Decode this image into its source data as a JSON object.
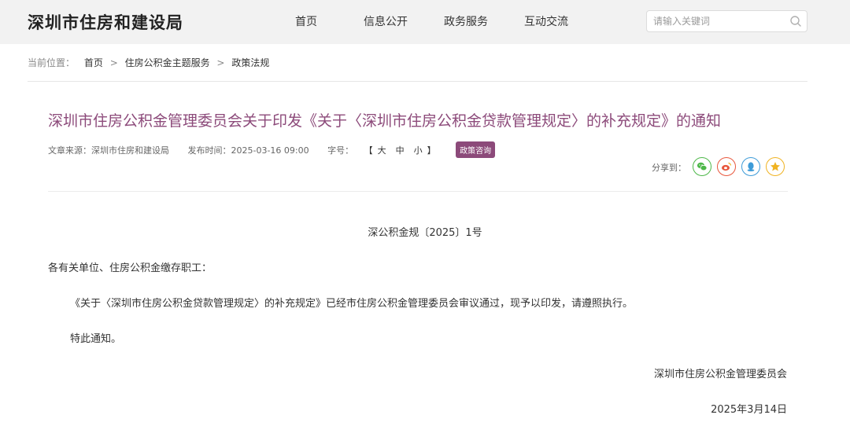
{
  "header": {
    "site_title": "深圳市住房和建设局",
    "nav": [
      "首页",
      "信息公开",
      "政务服务",
      "互动交流"
    ],
    "search_placeholder": "请输入关键词"
  },
  "breadcrumb": {
    "label": "当前位置：",
    "items": [
      "首页",
      "住房公积金主题服务",
      "政策法规"
    ],
    "separator": ">"
  },
  "article": {
    "title": "深圳市住房公积金管理委员会关于印发《关于〈深圳市住房公积金贷款管理规定〉的补充规定》的通知",
    "source": "文章来源：深圳市住房和建设局",
    "published": "发布时间：2025-03-16 09:00",
    "font_size_label": "字号：",
    "font_size_open": "【",
    "font_size_options": [
      "大",
      "中",
      "小"
    ],
    "font_size_close": "】",
    "badge": "政策咨询",
    "share_label": "分享到："
  },
  "body": {
    "doc_number": "深公积金规〔2025〕1号",
    "salutation": "各有关单位、住房公积金缴存职工：",
    "paragraph": "《关于〈深圳市住房公积金贷款管理规定〉的补充规定》已经市住房公积金管理委员会审议通过，现予以印发，请遵照执行。",
    "closing": "特此通知。",
    "signer": "深圳市住房公积金管理委员会",
    "date": "2025年3月14日"
  },
  "share_icons": [
    {
      "name": "wechat-icon",
      "color": "#4cb748"
    },
    {
      "name": "weibo-icon",
      "color": "#e8573c"
    },
    {
      "name": "qq-icon",
      "color": "#3d9bd8"
    },
    {
      "name": "favorite-star-icon",
      "color": "#f0b322"
    }
  ],
  "colors": {
    "accent": "#8c4a7a",
    "header_bg": "#f2f2f2"
  }
}
